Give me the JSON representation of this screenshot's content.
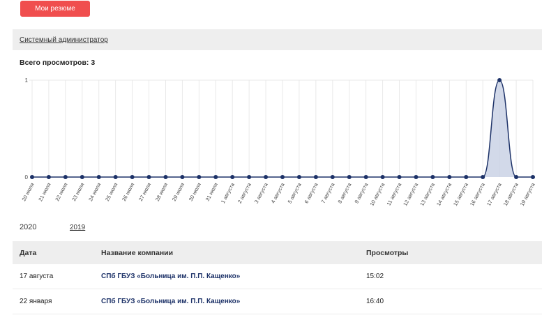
{
  "header": {
    "my_resumes_label": "Мои резюме"
  },
  "resume": {
    "title": "Системный администратор"
  },
  "stats": {
    "total_label": "Всего просмотров: 3"
  },
  "chart_data": {
    "type": "area",
    "categories": [
      "20 июля",
      "21 июля",
      "22 июля",
      "23 июля",
      "24 июля",
      "25 июля",
      "26 июля",
      "27 июля",
      "28 июля",
      "29 июля",
      "30 июля",
      "31 июля",
      "1 августа",
      "2 августа",
      "3 августа",
      "4 августа",
      "5 августа",
      "6 августа",
      "7 августа",
      "8 августа",
      "9 августа",
      "10 августа",
      "11 августа",
      "12 августа",
      "13 августа",
      "14 августа",
      "15 августа",
      "16 августа",
      "17 августа",
      "18 августа",
      "19 августа"
    ],
    "values": [
      0,
      0,
      0,
      0,
      0,
      0,
      0,
      0,
      0,
      0,
      0,
      0,
      0,
      0,
      0,
      0,
      0,
      0,
      0,
      0,
      0,
      0,
      0,
      0,
      0,
      0,
      0,
      0,
      1,
      0,
      0
    ],
    "yticks": [
      "0",
      "1"
    ],
    "ylim": [
      0,
      1
    ],
    "grid": true,
    "colors": {
      "line": "#1d3268",
      "fill": "#c7cfe3",
      "grid": "#e9e9e9"
    }
  },
  "years": {
    "current": "2020",
    "other": "2019"
  },
  "table": {
    "headers": [
      "Дата",
      "Название компании",
      "Просмотры"
    ],
    "rows": [
      {
        "date": "17 августа",
        "company": "СПб ГБУЗ «Больница им. П.П. Кащенко»",
        "views": "15:02"
      },
      {
        "date": "22 января",
        "company": "СПб ГБУЗ «Больница им. П.П. Кащенко»",
        "views": "16:40"
      }
    ]
  }
}
